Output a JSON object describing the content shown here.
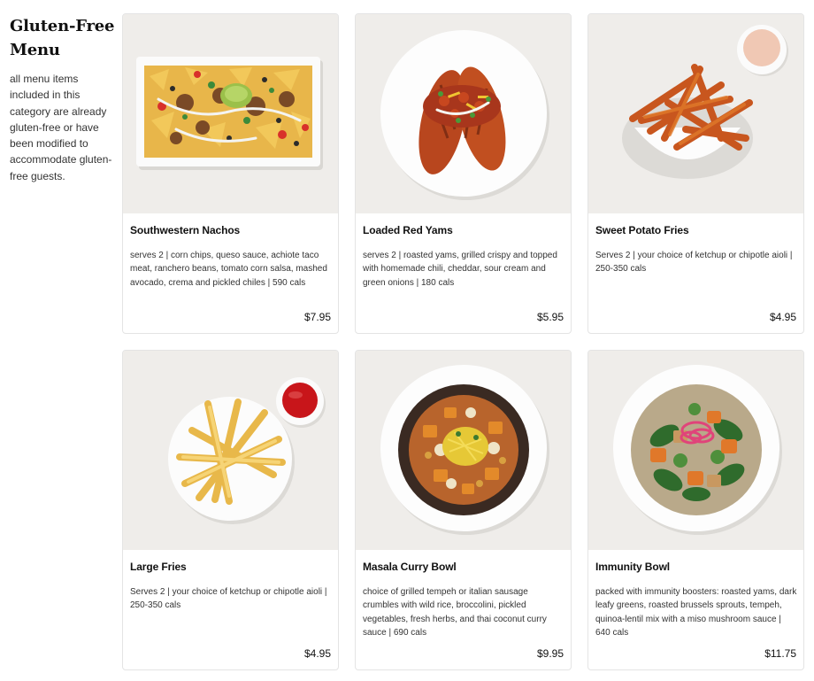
{
  "sidebar": {
    "title": "Gluten-Free Menu",
    "description": "all menu items included in this category are already gluten-free or have been modified to accommodate gluten-free guests."
  },
  "items": [
    {
      "name": "Southwestern Nachos",
      "description": "serves 2 | corn chips, queso sauce, achiote taco meat, ranchero beans, tomato corn salsa, mashed avocado, crema and pickled chiles | 590 cals",
      "price": "$7.95"
    },
    {
      "name": "Loaded Red Yams",
      "description": "serves 2 | roasted yams, grilled crispy and topped with homemade chili, cheddar, sour cream and green onions | 180 cals",
      "price": "$5.95"
    },
    {
      "name": "Sweet Potato Fries",
      "description": "Serves 2 | your choice of ketchup or chipotle aioli | 250-350 cals",
      "price": "$4.95"
    },
    {
      "name": "Large Fries",
      "description": "Serves 2 | your choice of ketchup or chipotle aioli | 250-350 cals",
      "price": "$4.95"
    },
    {
      "name": "Masala Curry Bowl",
      "description": "choice of grilled tempeh or italian sausage crumbles with wild rice, broccolini, pickled vegetables, fresh herbs, and thai coconut curry sauce | 690 cals",
      "price": "$9.95"
    },
    {
      "name": "Immunity Bowl",
      "description": "packed with immunity boosters: roasted yams, dark leafy greens, roasted brussels sprouts, tempeh, quinoa-lentil mix with a miso mushroom sauce | 640 cals",
      "price": "$11.75"
    }
  ]
}
